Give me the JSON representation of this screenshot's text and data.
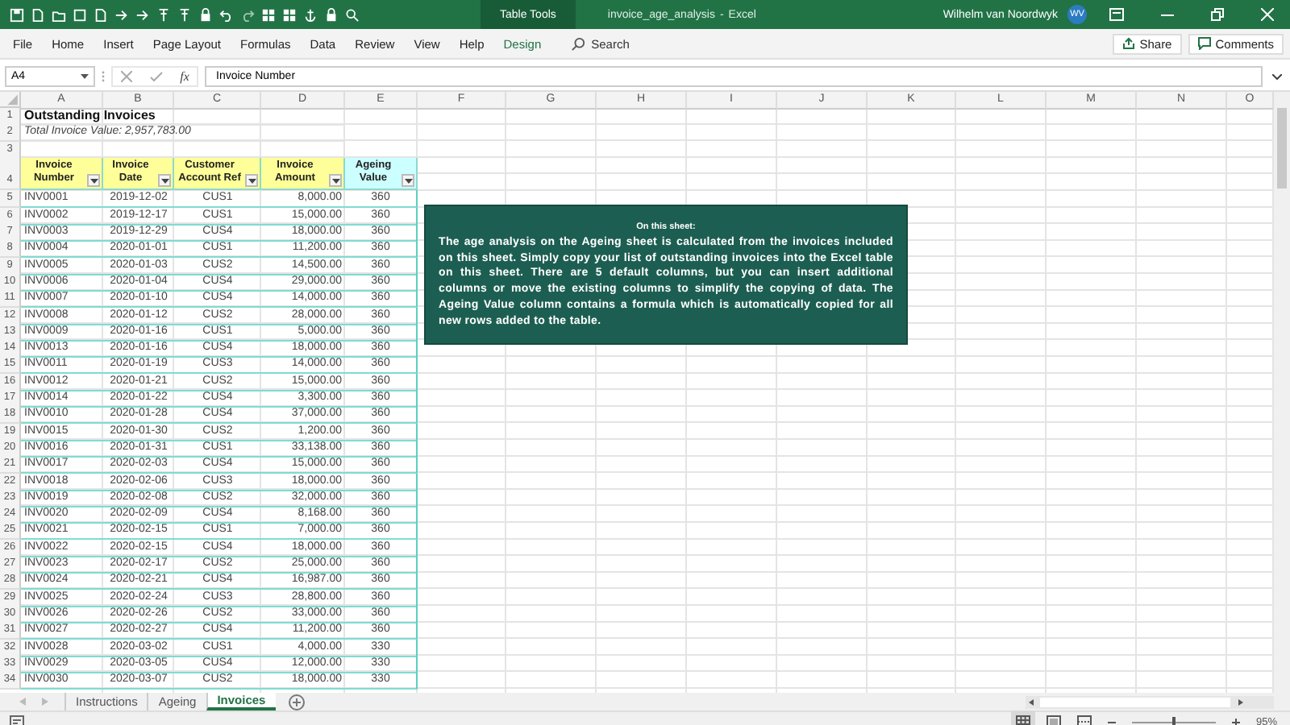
{
  "title_bar": {
    "contextual_tab": "Table Tools",
    "document": "invoice_age_analysis",
    "separator": "-",
    "app": "Excel",
    "user": "Wilhelm van Noordwyk",
    "initials": "WV"
  },
  "menu": [
    {
      "label": "File",
      "kind": "plain"
    },
    {
      "label": "Home",
      "kind": "plain"
    },
    {
      "label": "Insert",
      "kind": "plain"
    },
    {
      "label": "Page Layout",
      "kind": "plain"
    },
    {
      "label": "Formulas",
      "kind": "plain"
    },
    {
      "label": "Data",
      "kind": "plain"
    },
    {
      "label": "Review",
      "kind": "plain"
    },
    {
      "label": "View",
      "kind": "plain"
    },
    {
      "label": "Help",
      "kind": "plain"
    },
    {
      "label": "Design",
      "kind": "contextual"
    }
  ],
  "search": {
    "placeholder": "Search"
  },
  "share": "Share",
  "comments": "Comments",
  "formula_bar": {
    "name_box": "A4",
    "fx": "fx",
    "value": "Invoice Number"
  },
  "columns": [
    "A",
    "B",
    "C",
    "D",
    "E",
    "F",
    "G",
    "H",
    "I",
    "J",
    "K",
    "L",
    "M",
    "N",
    "O"
  ],
  "sheet_title": {
    "row": "1",
    "text": "Outstanding Invoices"
  },
  "sheet_subtitle": {
    "row": "2",
    "text": "Total Invoice Value: 2,957,783.00"
  },
  "blank_row": "3",
  "table_header": {
    "row": "4",
    "headers": [
      {
        "label": "Invoice Number",
        "kind": "input"
      },
      {
        "label": "Invoice Date",
        "kind": "input"
      },
      {
        "label": "Customer Account Ref",
        "kind": "input"
      },
      {
        "label": "Invoice Amount",
        "kind": "input"
      },
      {
        "label": "Ageing Value",
        "kind": "formula"
      }
    ]
  },
  "rows": [
    {
      "row": "5",
      "number": "INV0001",
      "date": "2019-12-02",
      "account": "CUS1",
      "amount": "8,000.00",
      "age": "360"
    },
    {
      "row": "6",
      "number": "INV0002",
      "date": "2019-12-17",
      "account": "CUS1",
      "amount": "15,000.00",
      "age": "360"
    },
    {
      "row": "7",
      "number": "INV0003",
      "date": "2019-12-29",
      "account": "CUS4",
      "amount": "18,000.00",
      "age": "360"
    },
    {
      "row": "8",
      "number": "INV0004",
      "date": "2020-01-01",
      "account": "CUS1",
      "amount": "11,200.00",
      "age": "360"
    },
    {
      "row": "9",
      "number": "INV0005",
      "date": "2020-01-03",
      "account": "CUS2",
      "amount": "14,500.00",
      "age": "360"
    },
    {
      "row": "10",
      "number": "INV0006",
      "date": "2020-01-04",
      "account": "CUS4",
      "amount": "29,000.00",
      "age": "360"
    },
    {
      "row": "11",
      "number": "INV0007",
      "date": "2020-01-10",
      "account": "CUS4",
      "amount": "14,000.00",
      "age": "360"
    },
    {
      "row": "12",
      "number": "INV0008",
      "date": "2020-01-12",
      "account": "CUS2",
      "amount": "28,000.00",
      "age": "360"
    },
    {
      "row": "13",
      "number": "INV0009",
      "date": "2020-01-16",
      "account": "CUS1",
      "amount": "5,000.00",
      "age": "360"
    },
    {
      "row": "14",
      "number": "INV0013",
      "date": "2020-01-16",
      "account": "CUS4",
      "amount": "18,000.00",
      "age": "360"
    },
    {
      "row": "15",
      "number": "INV0011",
      "date": "2020-01-19",
      "account": "CUS3",
      "amount": "14,000.00",
      "age": "360"
    },
    {
      "row": "16",
      "number": "INV0012",
      "date": "2020-01-21",
      "account": "CUS2",
      "amount": "15,000.00",
      "age": "360"
    },
    {
      "row": "17",
      "number": "INV0014",
      "date": "2020-01-22",
      "account": "CUS4",
      "amount": "3,300.00",
      "age": "360"
    },
    {
      "row": "18",
      "number": "INV0010",
      "date": "2020-01-28",
      "account": "CUS4",
      "amount": "37,000.00",
      "age": "360"
    },
    {
      "row": "19",
      "number": "INV0015",
      "date": "2020-01-30",
      "account": "CUS2",
      "amount": "1,200.00",
      "age": "360"
    },
    {
      "row": "20",
      "number": "INV0016",
      "date": "2020-01-31",
      "account": "CUS1",
      "amount": "33,138.00",
      "age": "360"
    },
    {
      "row": "21",
      "number": "INV0017",
      "date": "2020-02-03",
      "account": "CUS4",
      "amount": "15,000.00",
      "age": "360"
    },
    {
      "row": "22",
      "number": "INV0018",
      "date": "2020-02-06",
      "account": "CUS3",
      "amount": "18,000.00",
      "age": "360"
    },
    {
      "row": "23",
      "number": "INV0019",
      "date": "2020-02-08",
      "account": "CUS2",
      "amount": "32,000.00",
      "age": "360"
    },
    {
      "row": "24",
      "number": "INV0020",
      "date": "2020-02-09",
      "account": "CUS4",
      "amount": "8,168.00",
      "age": "360"
    },
    {
      "row": "25",
      "number": "INV0021",
      "date": "2020-02-15",
      "account": "CUS1",
      "amount": "7,000.00",
      "age": "360"
    },
    {
      "row": "26",
      "number": "INV0022",
      "date": "2020-02-15",
      "account": "CUS4",
      "amount": "18,000.00",
      "age": "360"
    },
    {
      "row": "27",
      "number": "INV0023",
      "date": "2020-02-17",
      "account": "CUS2",
      "amount": "25,000.00",
      "age": "360"
    },
    {
      "row": "28",
      "number": "INV0024",
      "date": "2020-02-21",
      "account": "CUS4",
      "amount": "16,987.00",
      "age": "360"
    },
    {
      "row": "29",
      "number": "INV0025",
      "date": "2020-02-24",
      "account": "CUS3",
      "amount": "28,800.00",
      "age": "360"
    },
    {
      "row": "30",
      "number": "INV0026",
      "date": "2020-02-26",
      "account": "CUS2",
      "amount": "33,000.00",
      "age": "360"
    },
    {
      "row": "31",
      "number": "INV0027",
      "date": "2020-02-27",
      "account": "CUS4",
      "amount": "11,200.00",
      "age": "360"
    },
    {
      "row": "32",
      "number": "INV0028",
      "date": "2020-03-02",
      "account": "CUS1",
      "amount": "4,000.00",
      "age": "330"
    },
    {
      "row": "33",
      "number": "INV0029",
      "date": "2020-03-05",
      "account": "CUS4",
      "amount": "12,000.00",
      "age": "330"
    },
    {
      "row": "34",
      "number": "INV0030",
      "date": "2020-03-07",
      "account": "CUS2",
      "amount": "18,000.00",
      "age": "330"
    }
  ],
  "note": {
    "title": "On this sheet:",
    "body": "The age analysis on the Ageing sheet is calculated from the invoices included on this sheet. Simply copy your list of outstanding invoices into the Excel table on this sheet. There are 5 default columns, but you can insert additional columns or move the existing columns to simplify the copying of data. The Ageing Value column contains a formula which is automatically copied for all new rows added to the table."
  },
  "sheet_tabs": [
    {
      "label": "Instructions",
      "selected": false
    },
    {
      "label": "Ageing",
      "selected": false
    },
    {
      "label": "Invoices",
      "selected": true
    }
  ],
  "status_bar": {
    "zoom": {
      "level": 0.48,
      "reading": "95%"
    }
  }
}
